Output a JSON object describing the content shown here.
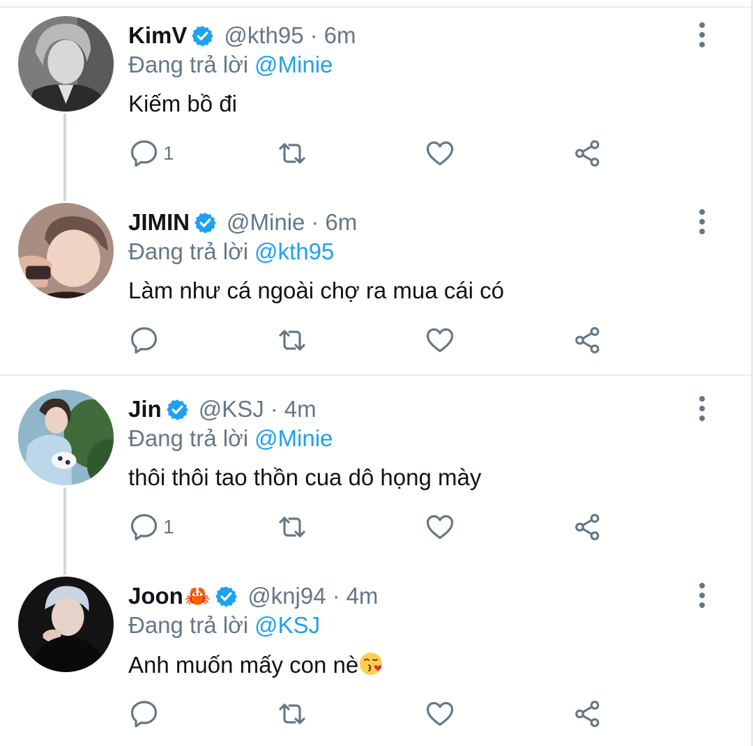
{
  "accent_color": "#1da1f2",
  "secondary_color": "#657786",
  "reply_prefix": "Đang trả lời",
  "icons": {
    "verified": "verified-badge-icon",
    "more": "more-vertical-icon",
    "reply": "reply-icon",
    "retweet": "retweet-icon",
    "like": "heart-icon",
    "share": "share-icon"
  },
  "tweets": [
    {
      "name": "KimV",
      "handle": "@kth95",
      "separator": "·",
      "time": "6m",
      "reply_to": "@Minie",
      "text": "Kiếm bồ đi",
      "reply_count": "1"
    },
    {
      "name": "JIMIN",
      "handle": "@Minie",
      "separator": "·",
      "time": "6m",
      "reply_to": "@kth95",
      "text": "Làm như cá ngoài chợ ra mua cái có",
      "reply_count": ""
    },
    {
      "name": "Jin",
      "handle": "@KSJ",
      "separator": "·",
      "time": "4m",
      "reply_to": "@Minie",
      "text": "thôi thôi tao thồn cua dô họng mày",
      "reply_count": "1"
    },
    {
      "name": "Joon",
      "name_emoji": "🦀",
      "handle": "@knj94",
      "separator": "·",
      "time": "4m",
      "reply_to": "@KSJ",
      "text": "Anh muốn mấy con nè",
      "reply_count": ""
    }
  ]
}
